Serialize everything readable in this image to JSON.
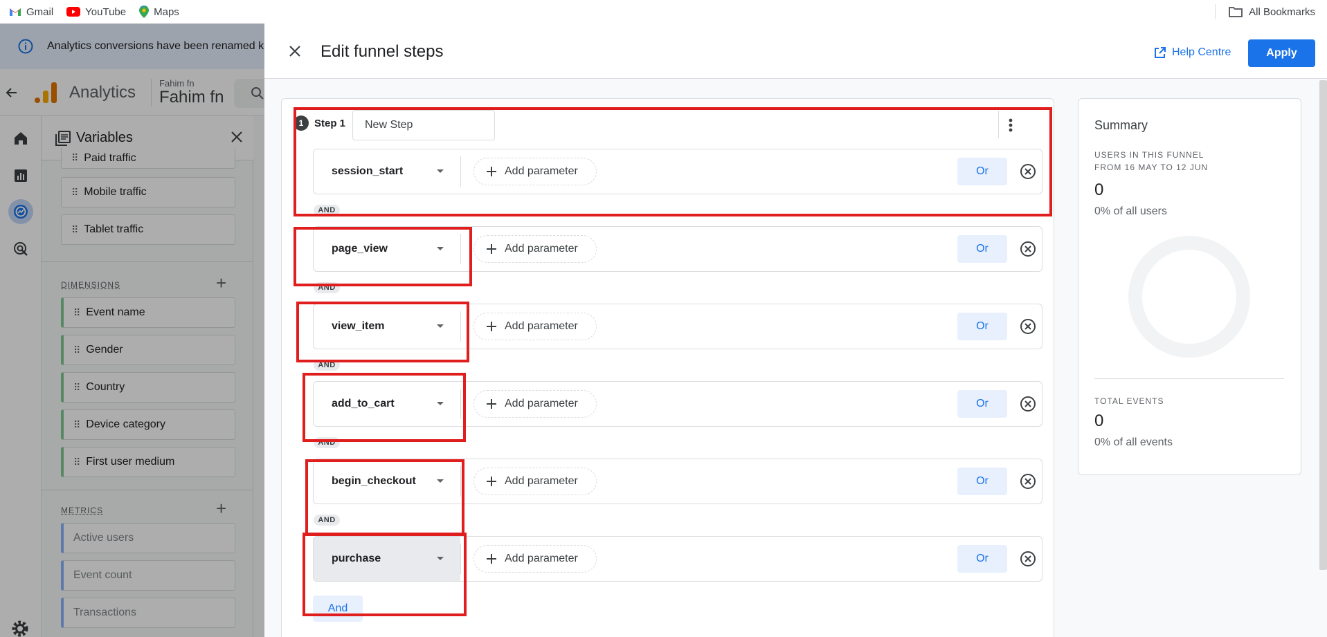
{
  "bookmarks": {
    "items": [
      {
        "label": "Gmail",
        "icon": "gmail-icon"
      },
      {
        "label": "YouTube",
        "icon": "youtube-icon"
      },
      {
        "label": "Maps",
        "icon": "maps-icon"
      }
    ],
    "all_bookmarks": "All Bookmarks"
  },
  "background_app": {
    "banner_text": "Analytics conversions have been renamed k",
    "app_name": "Analytics",
    "account_small": "Fahim fn",
    "account_big": "Fahim fn",
    "variables": {
      "title": "Variables",
      "segments": [
        "Paid traffic",
        "Mobile traffic",
        "Tablet traffic"
      ],
      "dimensions_label": "DIMENSIONS",
      "dimensions": [
        "Event name",
        "Gender",
        "Country",
        "Device category",
        "First user medium"
      ],
      "metrics_label": "METRICS",
      "metrics": [
        "Active users",
        "Event count",
        "Transactions"
      ]
    }
  },
  "modal": {
    "title": "Edit funnel steps",
    "help_label": "Help Centre",
    "apply_label": "Apply",
    "step": {
      "number": "1",
      "label": "Step 1",
      "name_value": "New Step"
    },
    "conditions": [
      {
        "event": "session_start",
        "add_param": "Add parameter",
        "or": "Or"
      },
      {
        "event": "page_view",
        "add_param": "Add parameter",
        "or": "Or"
      },
      {
        "event": "view_item",
        "add_param": "Add parameter",
        "or": "Or"
      },
      {
        "event": "add_to_cart",
        "add_param": "Add parameter",
        "or": "Or"
      },
      {
        "event": "begin_checkout",
        "add_param": "Add parameter",
        "or": "Or"
      },
      {
        "event": "purchase",
        "add_param": "Add parameter",
        "or": "Or"
      }
    ],
    "and_connector": "AND",
    "and_button": "And",
    "summary": {
      "title": "Summary",
      "users_label": "USERS IN THIS FUNNEL",
      "date_range": "FROM 16 MAY TO 12 JUN",
      "users_value": "0",
      "users_pct": "0% of all users",
      "events_label": "TOTAL EVENTS",
      "events_value": "0",
      "events_pct": "0% of all events"
    }
  },
  "colors": {
    "accent": "#1a73e8",
    "annotation_red": "#e01e1e",
    "dimension_green": "#81c995",
    "metric_blue": "#8ab4f8"
  }
}
